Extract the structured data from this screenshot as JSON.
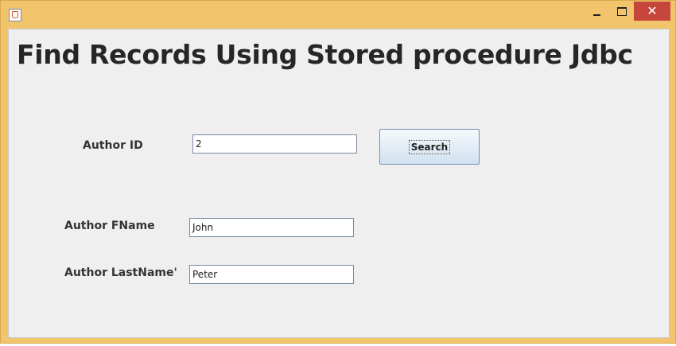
{
  "window": {
    "icon": "java-cup-icon",
    "controls": {
      "minimize": "minimize-icon",
      "maximize": "maximize-icon",
      "close": "close-icon"
    }
  },
  "form": {
    "title": "Find Records Using Stored procedure Jdbc",
    "author_id": {
      "label": "Author ID",
      "value": "2"
    },
    "search_button": "Search",
    "first_name": {
      "label": "Author FName",
      "value": "John"
    },
    "last_name": {
      "label": "Author LastName'",
      "value": "Peter"
    }
  },
  "colors": {
    "frame": "#f2c46c",
    "panel": "#efefef",
    "close_button": "#c7463c"
  }
}
